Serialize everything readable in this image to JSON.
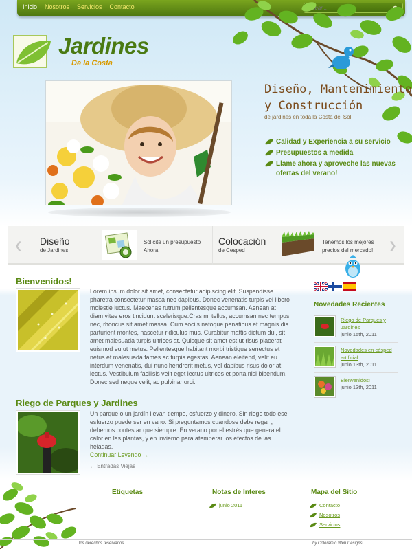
{
  "nav": {
    "items": [
      "Inicio",
      "Nosotros",
      "Servicios",
      "Contacto"
    ],
    "search_placeholder": "Buscar..."
  },
  "logo": {
    "title": "Jardines",
    "subtitle": "De la Costa"
  },
  "hero": {
    "tagline_line1": "Diseño, Mantenimiento",
    "tagline_line2": "y Construcción",
    "tagline_line3": "de jardines en toda la Costa del Sol",
    "bullets": [
      "Calidad y Experiencia a su servicio",
      "Presupuestos a medida",
      "Llame ahora y aproveche las nuevas ofertas del verano!"
    ]
  },
  "slider": {
    "panels": [
      {
        "title": "Diseño",
        "subtitle": "de Jardines",
        "text": "Solicite un presupuesto Ahora!"
      },
      {
        "title": "Colocación",
        "subtitle": "de Cesped",
        "text": "Tenemos los mejores precios del mercado!"
      }
    ]
  },
  "posts": [
    {
      "title": "Bienvenidos!",
      "body": "Lorem ipsum dolor sit amet, consectetur adipiscing elit. Suspendisse pharetra consectetur massa nec dapibus. Donec venenatis turpis vel libero molestie luctus. Maecenas rutrum pellentesque accumsan. Aenean at diam vitae eros tincidunt scelerisque.Cras mi tellus, accumsan nec tempus nec, rhoncus sit amet massa. Cum sociis natoque penatibus et magnis dis parturient montes, nascetur ridiculus mus. Curabitur mattis dictum dui, sit amet malesuada turpis ultrices at. Quisque sit amet est ut risus placerat euismod eu ut metus. Pellentesque habitant morbi tristique senectus et netus et malesuada fames ac turpis egestas. Aenean eleifend, velit eu interdum venenatis, dui nunc hendrerit metus, vel dapibus risus dolor at lectus. Vestibulum facilisis velit eget lectus ultrices et porta nisi bibendum. Donec sed neque velit, ac pulvinar orci."
    },
    {
      "title": "Riego de Parques y Jardines",
      "body": "Un parque o un jardín llevan tiempo, esfuerzo y dinero. Sin riego todo ese esfuerzo puede ser en vano. Si preguntamos cuandose debe regar , debemos contestar que siempre. En verano por el estrés que genera el calor en las plantas, y en invierno para atemperar los efectos de las heladas.",
      "more_link": "Continuar Leyendo →"
    }
  ],
  "older_entries": "← Entradas Viejas",
  "sidebar": {
    "title": "Novedades Recientes",
    "items": [
      {
        "title": "Riego de Parques y Jardines",
        "date": "junio 15th, 2011"
      },
      {
        "title": "Novedades en césped artificial",
        "date": "junio 13th, 2011"
      },
      {
        "title": "Bienvenidos!",
        "date": "junio 13th, 2011"
      }
    ]
  },
  "footer": {
    "col1_title": "Etiquetas",
    "col2_title": "Notas de Interes",
    "col2_links": [
      "junio 2011"
    ],
    "col3_title": "Mapa del Sitio",
    "col3_links": [
      "Contacto",
      "Nosotros",
      "Servicios"
    ],
    "copyright": "los derechos reservados",
    "credits": "by Coloramio Web Designs"
  },
  "colors": {
    "brand_green": "#5a8a14",
    "nav_green": "#4d7610",
    "accent_yellow": "#d89a00",
    "tagline_brown": "#7a4a1a"
  }
}
